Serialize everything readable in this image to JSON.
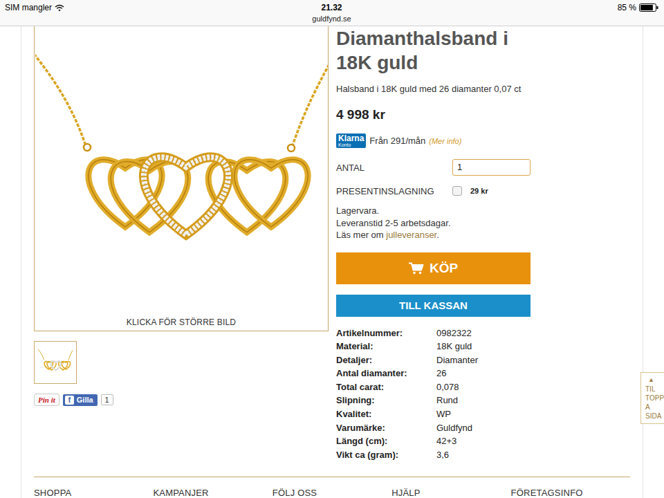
{
  "status_bar": {
    "carrier": "SIM mangler",
    "time": "21.32",
    "url": "guldfynd.se",
    "battery": "85 %",
    "battery_level": 0.85
  },
  "image": {
    "caption": "KLICKA FÖR STÖRRE BILD"
  },
  "thumbnails": [
    {
      "selected": true
    }
  ],
  "social": {
    "pin": "Pin it",
    "fb_icon": "f",
    "like": "Gilla",
    "like_count": "1"
  },
  "product": {
    "title": "Diamanthalsband i 18K guld",
    "subtitle": "Halsband i 18K guld med 26 diamanter 0,07 ct",
    "price": "4 998 kr"
  },
  "klarna": {
    "logo": "Klarna",
    "logo_sub": "Konto",
    "text": "Från 291/mån",
    "link": "(Mer info)"
  },
  "quantity": {
    "label": "ANTAL",
    "value": "1"
  },
  "gift_wrap": {
    "label": "PRESENTINSLAGNING",
    "checked": false,
    "price": "29 kr"
  },
  "stock": {
    "status": "Lagervara.",
    "delivery": "Leveranstid 2-5 arbetsdagar.",
    "more_prefix": "Läs mer om",
    "more_link": "julleveranser",
    "more_suffix": "."
  },
  "buttons": {
    "buy": "KÖP",
    "checkout": "TILL KASSAN"
  },
  "specs": [
    {
      "label": "Artikelnummer:",
      "value": "0982322"
    },
    {
      "label": "Material:",
      "value": "18K guld"
    },
    {
      "label": "Detaljer:",
      "value": "Diamanter"
    },
    {
      "label": "Antal diamanter:",
      "value": "26"
    },
    {
      "label": "Total carat:",
      "value": "0,078"
    },
    {
      "label": "Slipning:",
      "value": "Rund"
    },
    {
      "label": "Kvalitet:",
      "value": "WP"
    },
    {
      "label": "Varumärke:",
      "value": "Guldfynd"
    },
    {
      "label": "Längd (cm):",
      "value": "42+3"
    },
    {
      "label": "Vikt ca (gram):",
      "value": "3,6"
    }
  ],
  "scroll_top": {
    "icon": "▲",
    "lines": [
      "TIL",
      "TOPP",
      "A",
      "SIDA"
    ]
  },
  "footer": [
    "SHOPPA",
    "KAMPANJER",
    "FÖLJ OSS",
    "HJÄLP",
    "FÖRETAGSINFO"
  ]
}
